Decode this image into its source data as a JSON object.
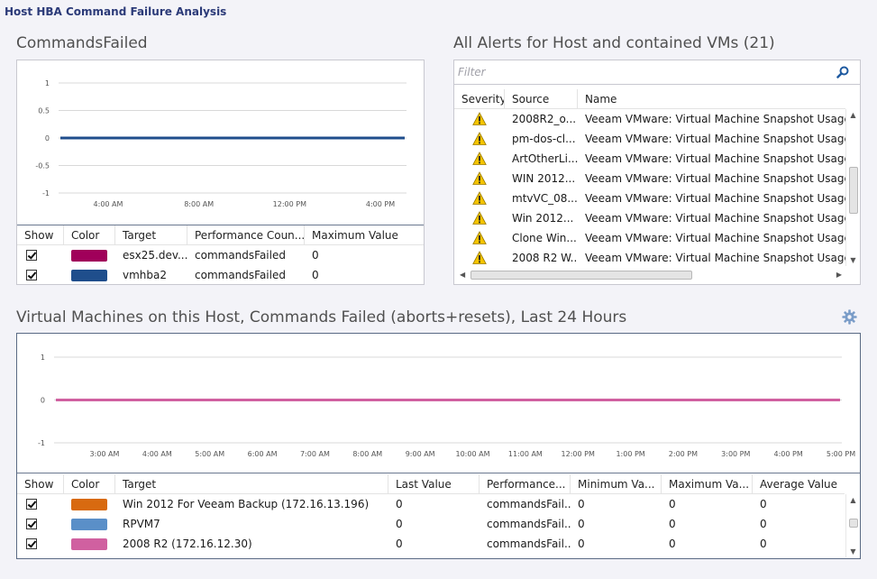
{
  "page": {
    "title": "Host HBA Command Failure Analysis"
  },
  "commands_failed": {
    "title": "CommandsFailed",
    "chart_data": {
      "type": "line",
      "y_ticks": [
        "1",
        "0.5",
        "0",
        "-0.5",
        "-1"
      ],
      "x_ticks": [
        "4:00 AM",
        "8:00 AM",
        "12:00 PM",
        "4:00 PM"
      ],
      "ylim": [
        -1,
        1
      ],
      "series": [
        {
          "name": "esx25.dev...",
          "color": "#a0005a",
          "values": [
            0,
            0
          ]
        },
        {
          "name": "vmhba2",
          "color": "#1f4e8c",
          "values": [
            0,
            0
          ]
        }
      ]
    },
    "columns": [
      "Show",
      "Color",
      "Target",
      "Performance Coun...",
      "Maximum Value"
    ],
    "rows": [
      {
        "color": "#a0005a",
        "target": "esx25.dev...",
        "counter": "commandsFailed",
        "max": "0"
      },
      {
        "color": "#1f4e8c",
        "target": "vmhba2",
        "counter": "commandsFailed",
        "max": "0"
      }
    ]
  },
  "alerts": {
    "title": "All Alerts for Host and contained VMs (21)",
    "filter_placeholder": "Filter",
    "columns": [
      "Severity",
      "Source",
      "Name"
    ],
    "rows": [
      {
        "source": "2008R2_o...",
        "name": "Veeam VMware: Virtual Machine Snapshot Usage Analy"
      },
      {
        "source": "pm-dos-cl...",
        "name": "Veeam VMware: Virtual Machine Snapshot Usage Analy"
      },
      {
        "source": "ArtOtherLi...",
        "name": "Veeam VMware: Virtual Machine Snapshot Usage Analy"
      },
      {
        "source": "WIN 2012...",
        "name": "Veeam VMware: Virtual Machine Snapshot Usage Analy"
      },
      {
        "source": "mtvVC_08...",
        "name": "Veeam VMware: Virtual Machine Snapshot Usage Analy"
      },
      {
        "source": "Win 2012...",
        "name": "Veeam VMware: Virtual Machine Snapshot Usage Analy"
      },
      {
        "source": "Clone Win...",
        "name": "Veeam VMware: Virtual Machine Snapshot Usage Analy"
      },
      {
        "source": "2008 R2 W...",
        "name": "Veeam VMware: Virtual Machine Snapshot Usage Analy"
      }
    ]
  },
  "vms": {
    "title": "Virtual Machines on this Host, Commands Failed (aborts+resets), Last 24 Hours",
    "chart_data": {
      "type": "line",
      "y_ticks": [
        "1",
        "0",
        "-1"
      ],
      "x_ticks": [
        "3:00 AM",
        "4:00 AM",
        "5:00 AM",
        "6:00 AM",
        "7:00 AM",
        "8:00 AM",
        "9:00 AM",
        "10:00 AM",
        "11:00 AM",
        "12:00 PM",
        "1:00 PM",
        "2:00 PM",
        "3:00 PM",
        "4:00 PM",
        "5:00 PM"
      ],
      "ylim": [
        -1,
        1
      ],
      "series": [
        {
          "name": "Win 2012 For Veeam Backup (172.16.13.196)",
          "color": "#d86a10",
          "values": [
            0,
            0
          ]
        },
        {
          "name": "RPVM7",
          "color": "#5a8fc8",
          "values": [
            0,
            0
          ]
        },
        {
          "name": "2008 R2 (172.16.12.30)",
          "color": "#d060a0",
          "values": [
            0,
            0
          ]
        }
      ]
    },
    "columns": [
      "Show",
      "Color",
      "Target",
      "Last Value",
      "Performance...",
      "Minimum Va...",
      "Maximum Va...",
      "Average Value"
    ],
    "rows": [
      {
        "color": "#d86a10",
        "target": "Win 2012 For Veeam Backup (172.16.13.196)",
        "last": "0",
        "perf": "commandsFail...",
        "min": "0",
        "max": "0",
        "avg": "0"
      },
      {
        "color": "#5a8fc8",
        "target": "RPVM7",
        "last": "0",
        "perf": "commandsFail...",
        "min": "0",
        "max": "0",
        "avg": "0"
      },
      {
        "color": "#d060a0",
        "target": "2008 R2 (172.16.12.30)",
        "last": "0",
        "perf": "commandsFail...",
        "min": "0",
        "max": "0",
        "avg": "0"
      }
    ]
  }
}
